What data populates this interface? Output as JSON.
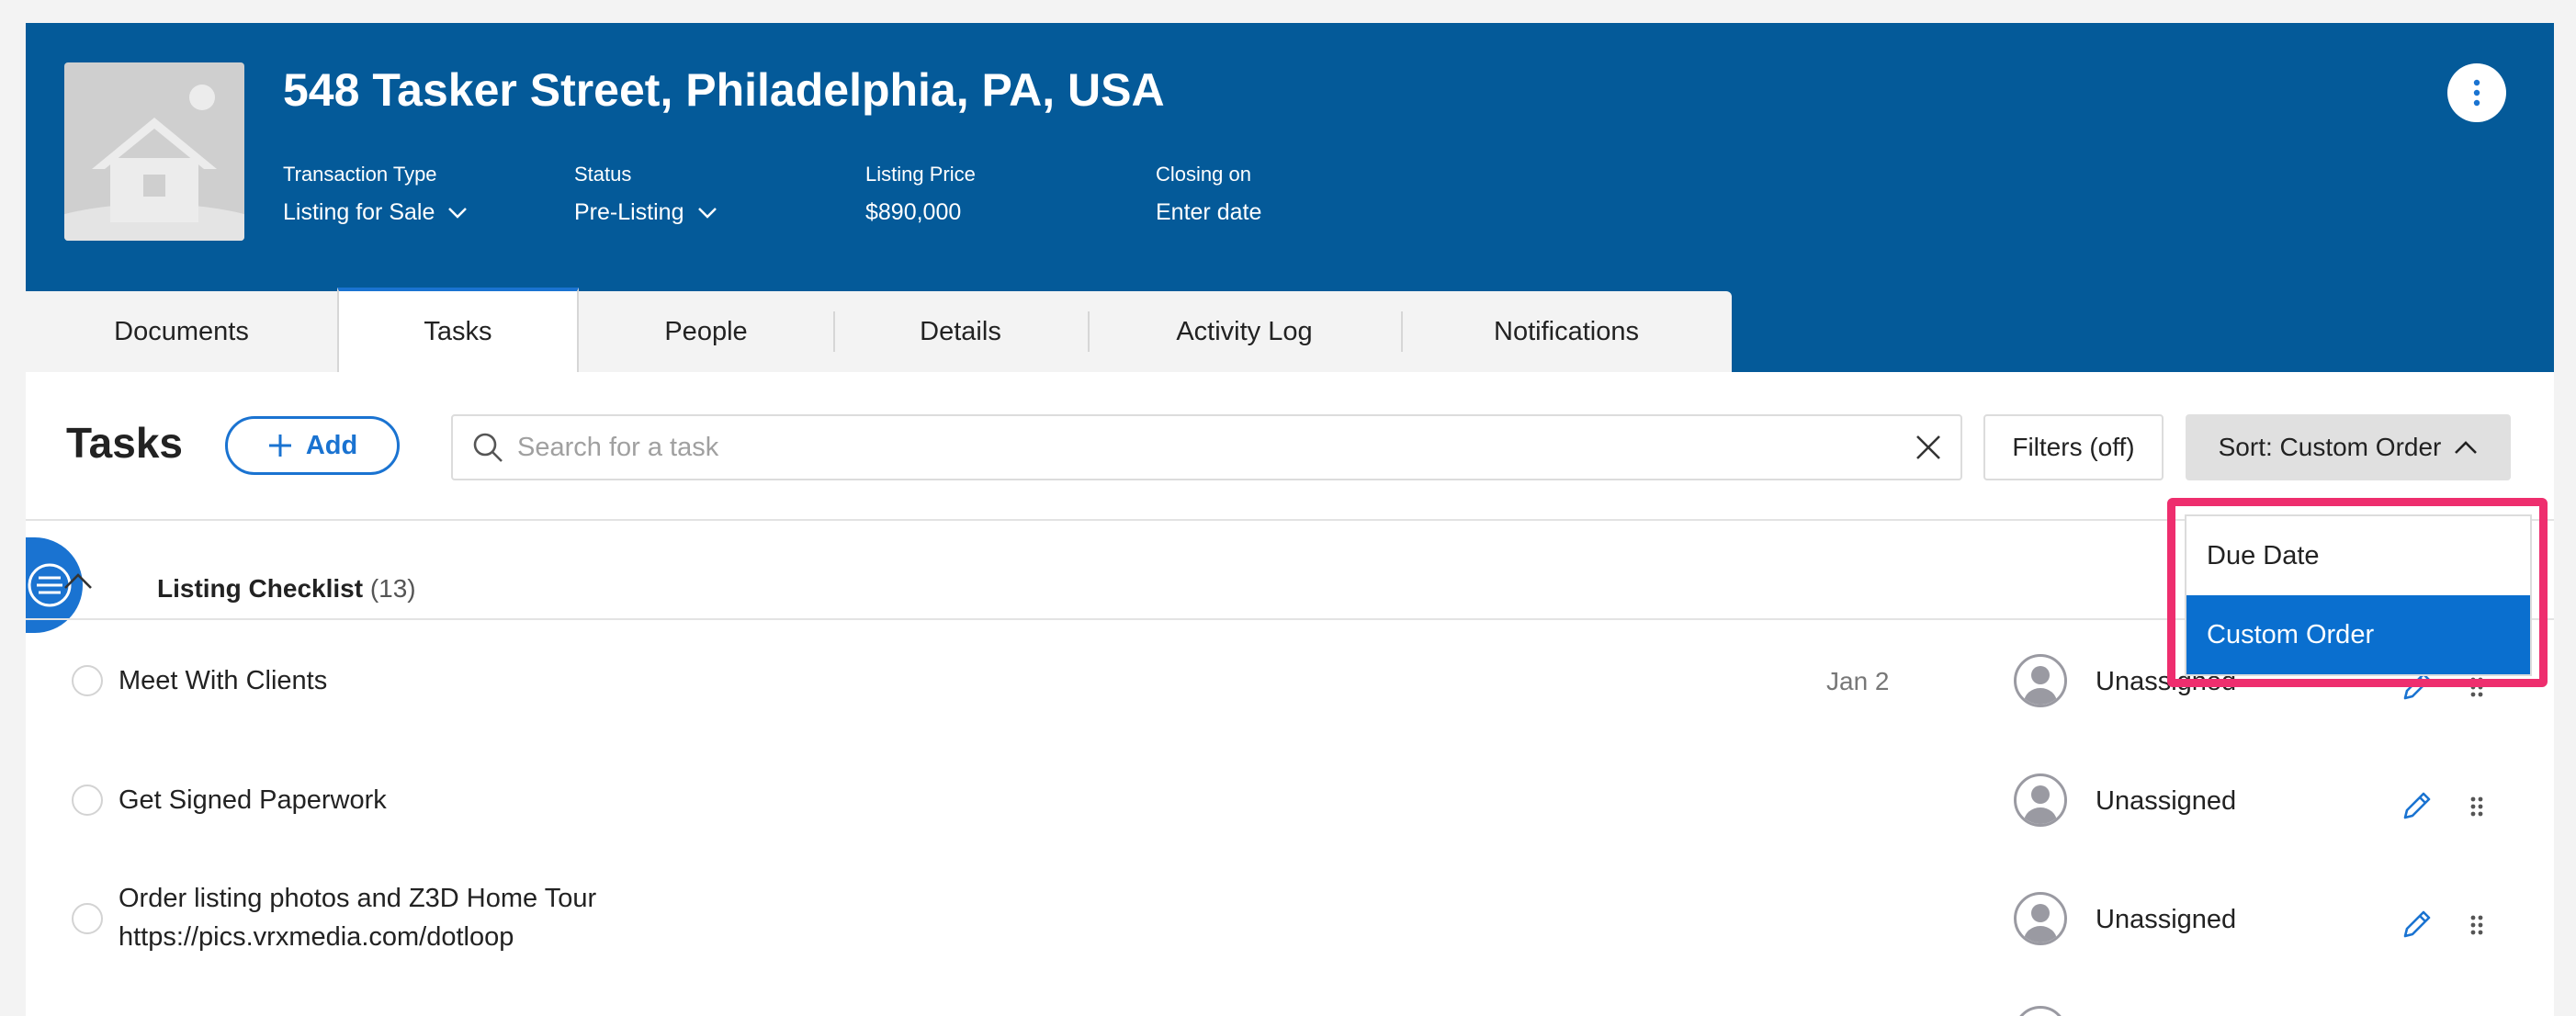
{
  "header": {
    "address": "548 Tasker Street, Philadelphia, PA, USA",
    "transaction_type_label": "Transaction Type",
    "transaction_type_value": "Listing for Sale",
    "status_label": "Status",
    "status_value": "Pre-Listing",
    "listing_price_label": "Listing Price",
    "listing_price_value": "$890,000",
    "closing_label": "Closing on",
    "closing_value": "Enter date",
    "colors": {
      "header_bg": "#045a99",
      "accent": "#1a73d1",
      "highlight": "#ee2e6e"
    }
  },
  "tabs": [
    {
      "label": "Documents",
      "active": false
    },
    {
      "label": "Tasks",
      "active": true
    },
    {
      "label": "People",
      "active": false
    },
    {
      "label": "Details",
      "active": false
    },
    {
      "label": "Activity Log",
      "active": false
    },
    {
      "label": "Notifications",
      "active": false
    }
  ],
  "toolbar": {
    "title": "Tasks",
    "add_label": "Add",
    "search_placeholder": "Search for a task",
    "filters_label": "Filters (off)",
    "sort_label": "Sort: Custom Order"
  },
  "sort_menu": {
    "options": [
      "Due Date",
      "Custom Order"
    ],
    "selected": "Custom Order"
  },
  "group": {
    "title": "Listing Checklist",
    "count": "(13)"
  },
  "tasks": [
    {
      "name": "Meet With Clients",
      "link": "",
      "due": "Jan 2",
      "assignee": "Unassigned"
    },
    {
      "name": "Get Signed Paperwork",
      "link": "",
      "due": "",
      "assignee": "Unassigned"
    },
    {
      "name": "Order listing photos and Z3D Home Tour",
      "link": "https://pics.vrxmedia.com/dotloop",
      "due": "",
      "assignee": "Unassigned"
    }
  ]
}
